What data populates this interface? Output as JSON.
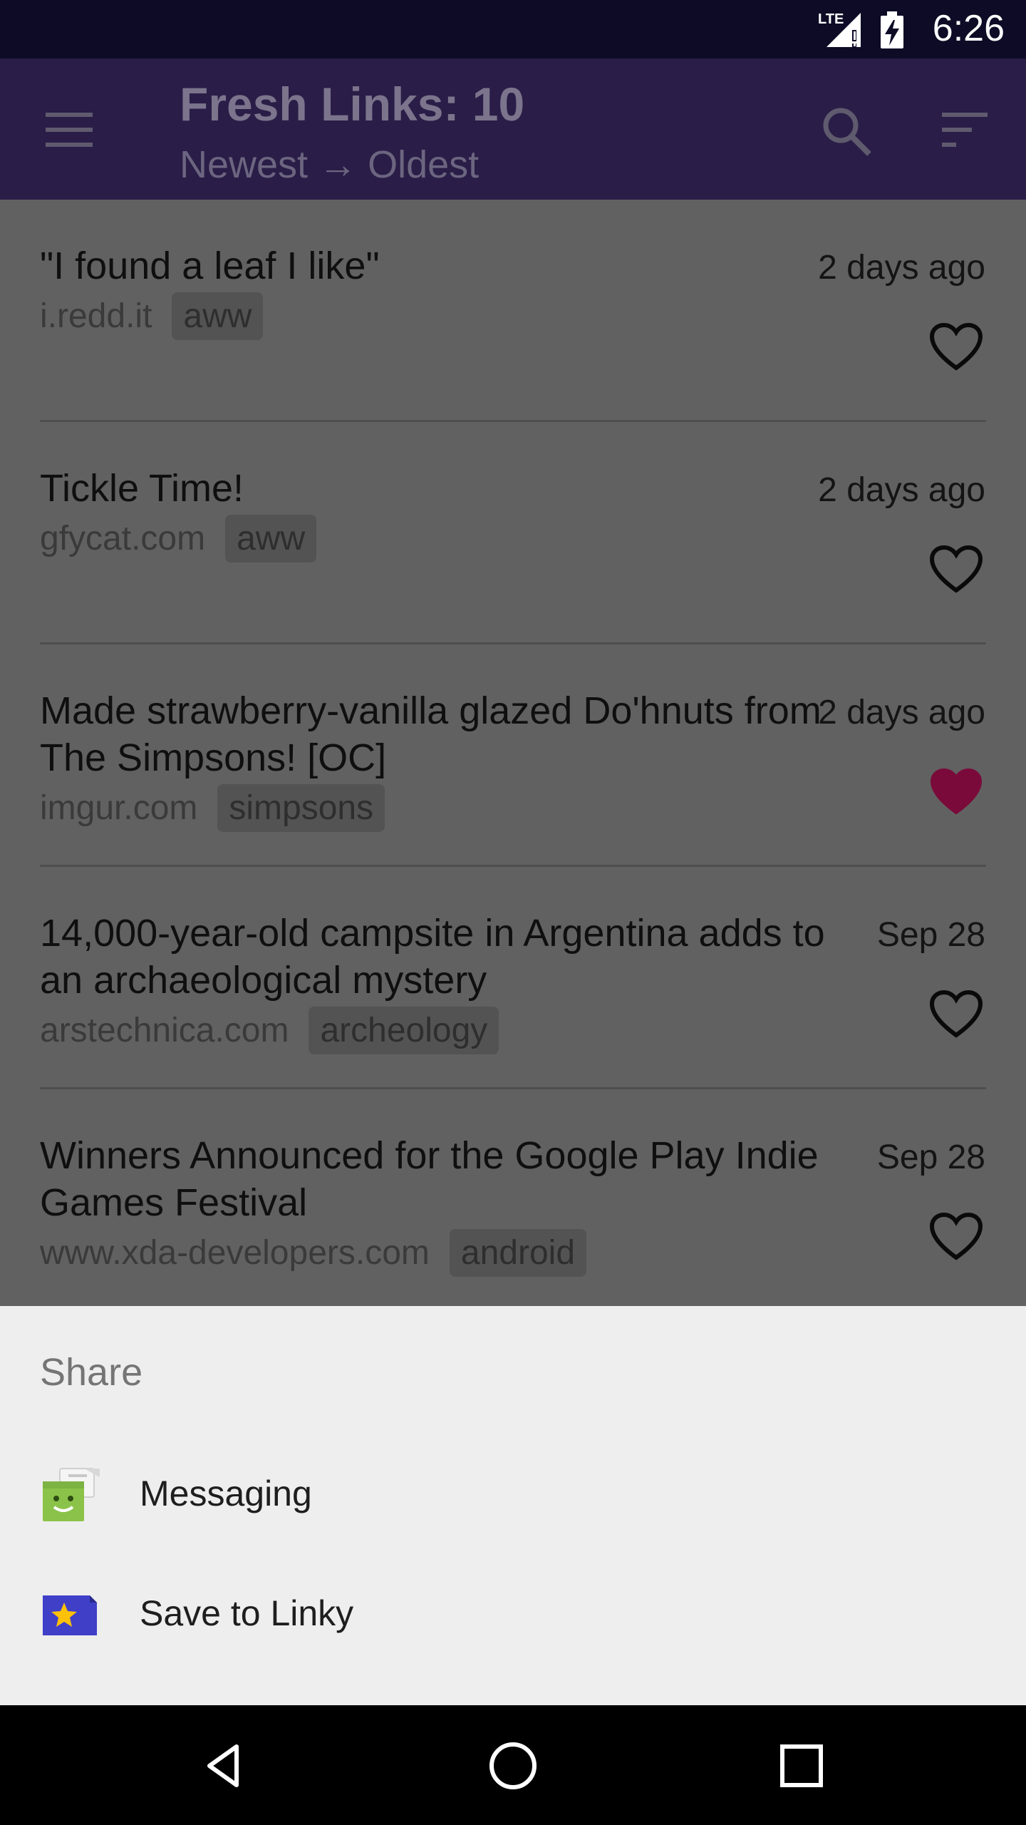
{
  "status_bar": {
    "time": "6:26",
    "network_label": "LTE",
    "icons": [
      "signal-icon",
      "battery-icon"
    ]
  },
  "app_bar": {
    "title": "Fresh Links: 10",
    "subtitle": "Newest → Oldest",
    "icons": [
      "menu-icon",
      "search-icon",
      "sort-icon"
    ]
  },
  "links": [
    {
      "title": "\"I found a leaf I like\"",
      "time": "2 days ago",
      "domain": "i.redd.it",
      "tag": "aww",
      "favorited": false
    },
    {
      "title": "Tickle Time!",
      "time": "2 days ago",
      "domain": "gfycat.com",
      "tag": "aww",
      "favorited": false
    },
    {
      "title": "Made strawberry-vanilla glazed Do'hnuts from The Simpsons! [OC]",
      "time": "2 days ago",
      "domain": "imgur.com",
      "tag": "simpsons",
      "favorited": true
    },
    {
      "title": "14,000-year-old campsite in Argentina adds to an archaeological mystery",
      "time": "Sep 28",
      "domain": "arstechnica.com",
      "tag": "archeology",
      "favorited": false
    },
    {
      "title": "Winners Announced for the Google Play Indie Games Festival",
      "time": "Sep 28",
      "domain": "www.xda-developers.com",
      "tag": "android",
      "favorited": false
    }
  ],
  "share_sheet": {
    "title": "Share",
    "items": [
      {
        "label": "Messaging",
        "icon": "messaging-app-icon"
      },
      {
        "label": "Save to Linky",
        "icon": "linky-app-icon"
      }
    ]
  },
  "nav_bar": {
    "icons": [
      "back-icon",
      "home-icon",
      "recents-icon"
    ]
  },
  "colors": {
    "status_bar": "#0e0b26",
    "app_bar": "#2a1d47",
    "favorite_heart": "#7a0a3a",
    "sheet_bg": "#eeeeee"
  }
}
